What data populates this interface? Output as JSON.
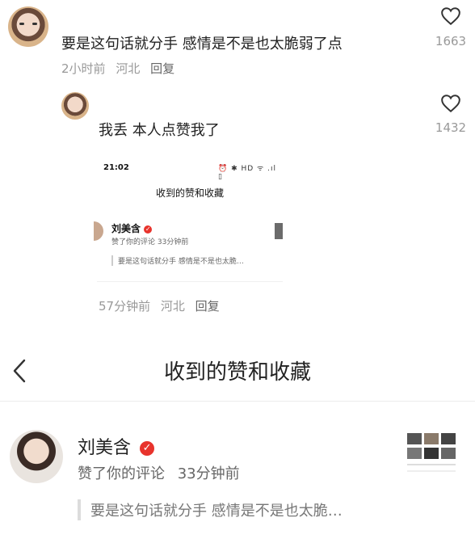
{
  "comments": [
    {
      "text": "要是这句话就分手 感情是不是也太脆弱了点",
      "time": "2小时前",
      "location": "河北",
      "reply_label": "回复",
      "likes": "1663"
    },
    {
      "text": "我丢 本人点赞我了",
      "time": "57分钟前",
      "location": "河北",
      "reply_label": "回复",
      "likes": "1432"
    }
  ],
  "embedded_screenshot": {
    "time": "21:02",
    "status_icons": "⏰ ✱ HD ᯤ .ıl ▯",
    "title": "收到的赞和收藏",
    "name": "刘美含",
    "subtitle": "赞了你的评论  33分钟前",
    "quote": "要是这句话就分手 感情是不是也太脆…"
  },
  "notification_page": {
    "title": "收到的赞和收藏",
    "item": {
      "name": "刘美含",
      "action": "赞了你的评论",
      "time": "33分钟前",
      "quote": "要是这句话就分手 感情是不是也太脆…"
    }
  },
  "colors": {
    "verified_badge": "#e8332c",
    "meta_gray": "#999999"
  }
}
